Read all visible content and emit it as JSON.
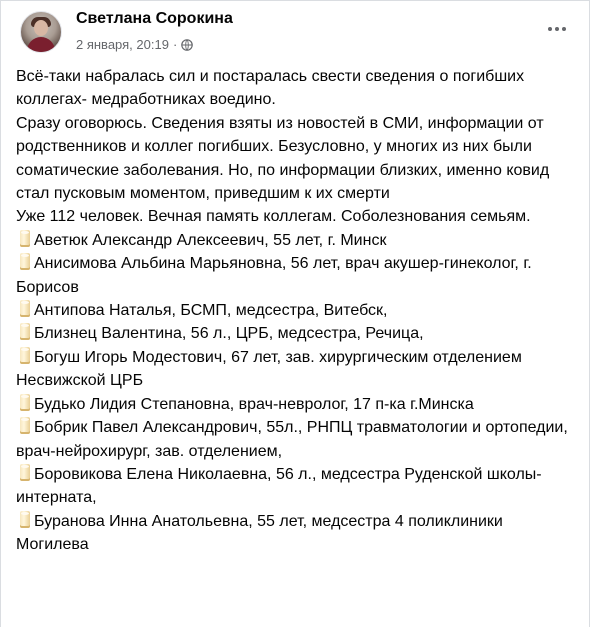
{
  "post": {
    "author": "Светлана Сорокина",
    "date": "2 января, 20:19",
    "separator": "·",
    "privacy_icon": "globe-icon",
    "more_icon": "more-options-icon",
    "intro": [
      "Всё-таки набралась сил и постаралась свести сведения о погибших коллегах- медработниках воедино.",
      "Сразу оговорюсь. Сведения взяты из новостей в СМИ, информации от родственников и коллег погибших. Безусловно, у многих из них были соматические заболевания. Но, по информации близких, именно ковид стал пусковым моментом, приведшим к их смерти"
    ],
    "count_text": "Уже 112 человек.  Вечная память коллегам. Соболезнования семьям.",
    "list_icon": "candle-icon",
    "people": [
      "Аветюк Александр Алексеевич, 55 лет, г. Минск",
      "Анисимова Альбина Марьяновна, 56 лет, врач акушер-гинеколог, г. Борисов",
      "Антипова Наталья,  БСМП, медсестра,  Витебск,",
      "Близнец Валентина,  56 л., ЦРБ,  медсестра,  Речица,",
      "Богуш Игорь Модестович,  67 лет, зав. хирургическим отделением Несвижской ЦРБ",
      "Будько Лидия Степановна, врач-невролог, 17 п-ка г.Минска",
      "Бобрик Павел Александрович, 55л., РНПЦ травматологии и ортопедии,  врач-нейрохирург,  зав. отделением,",
      "Боровикова Елена Николаевна, 56 л., медсестра Руденской школы-интерната,",
      "Буранова Инна Анатольевна, 55 лет, медсестра 4 поликлиники Могилева"
    ]
  }
}
